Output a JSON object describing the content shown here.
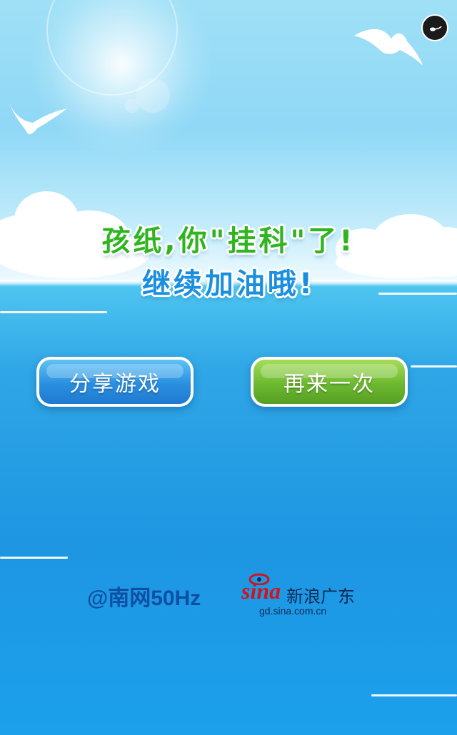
{
  "message": {
    "line1": "孩纸,你\"挂科\"了!",
    "line2": "继续加油哦!"
  },
  "buttons": {
    "share_label": "分享游戏",
    "replay_label": "再来一次"
  },
  "sponsors": {
    "southern_grid": "@南网50Hz",
    "sina_logo": "sina",
    "sina_name": "新浪广东",
    "sina_url": "gd.sina.com.cn"
  },
  "icons": {
    "music": "music-note-icon"
  },
  "colors": {
    "line1": "#30b521",
    "line2": "#1a8fe0",
    "share_button": "#2a8fe0",
    "replay_button": "#6cb930",
    "sina_red": "#d0141a"
  }
}
